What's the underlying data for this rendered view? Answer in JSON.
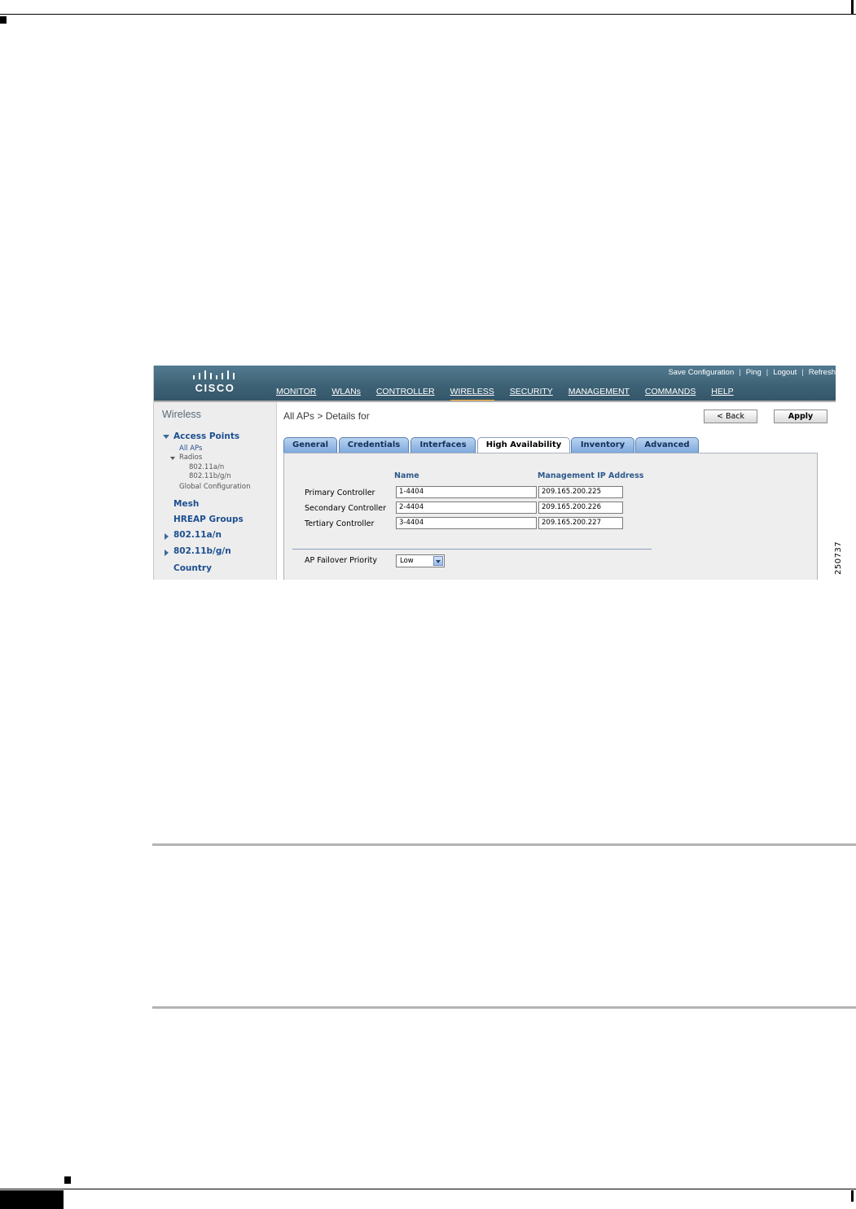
{
  "figure": {
    "id": "250737"
  },
  "app": {
    "logo": {
      "word": "CISCO"
    },
    "top_links": [
      "Save Configuration",
      "Ping",
      "Logout",
      "Refresh"
    ],
    "nav": [
      {
        "label": "MONITOR",
        "active": false
      },
      {
        "label": "WLANs",
        "active": false
      },
      {
        "label": "CONTROLLER",
        "active": false
      },
      {
        "label": "WIRELESS",
        "active": true
      },
      {
        "label": "SECURITY",
        "active": false
      },
      {
        "label": "MANAGEMENT",
        "active": false
      },
      {
        "label": "COMMANDS",
        "active": false
      },
      {
        "label": "HELP",
        "active": false
      }
    ],
    "colors": {
      "header": "#3d6174",
      "active_nav": "#f5a623",
      "tab_blue": "#7fa9dc",
      "link_blue": "#1d4f91"
    }
  },
  "sidebar": {
    "title": "Wireless",
    "access_points": "Access Points",
    "all_aps": "All APs",
    "radios": "Radios",
    "radio_a": "802.11a/n",
    "radio_bg": "802.11b/g/n",
    "global_config": "Global Configuration",
    "mesh": "Mesh",
    "hreap": "HREAP Groups",
    "band_a": "802.11a/n",
    "band_bg": "802.11b/g/n",
    "country": "Country"
  },
  "main": {
    "breadcrumb": "All APs > Details for",
    "back_label": "< Back",
    "apply_label": "Apply",
    "tabs": [
      "General",
      "Credentials",
      "Interfaces",
      "High Availability",
      "Inventory",
      "Advanced"
    ],
    "active_tab": "High Availability",
    "columns": {
      "name": "Name",
      "ip": "Management IP Address"
    },
    "controllers": [
      {
        "label": "Primary Controller",
        "name": "1-4404",
        "ip": "209.165.200.225"
      },
      {
        "label": "Secondary Controller",
        "name": "2-4404",
        "ip": "209.165.200.226"
      },
      {
        "label": "Tertiary Controller",
        "name": "3-4404",
        "ip": "209.165.200.227"
      }
    ],
    "failover_label": "AP Failover Priority",
    "failover_value": "Low"
  }
}
